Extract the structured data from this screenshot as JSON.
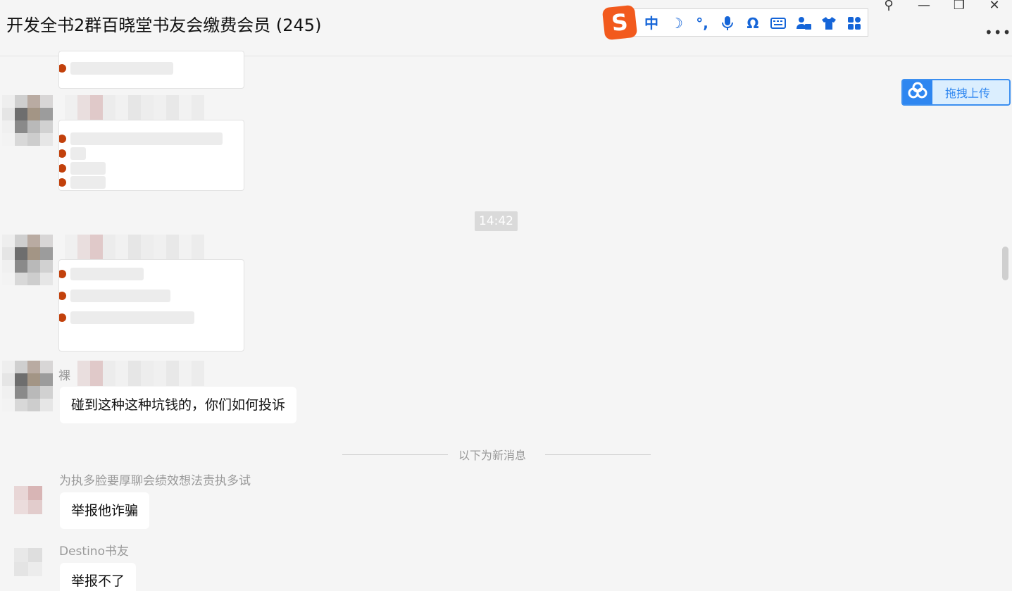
{
  "window": {
    "title": "开发全书2群百晓堂书友会缴费会员 (245)",
    "controls": {
      "pin": "⚲",
      "minimize": "—",
      "restore": "❐",
      "close": "✕",
      "more": "•••"
    }
  },
  "ime_toolbar": {
    "logo": "S",
    "items": [
      {
        "icon": "chinese-mode-icon",
        "glyph": "中"
      },
      {
        "icon": "moon-icon",
        "glyph": "☽"
      },
      {
        "icon": "punctuation-icon",
        "glyph": "°,"
      },
      {
        "icon": "microphone-icon",
        "glyph": "🎙"
      },
      {
        "icon": "omega-icon",
        "glyph": "Ω"
      },
      {
        "icon": "keyboard-icon",
        "glyph": "⌨"
      },
      {
        "icon": "user-card-icon",
        "glyph": "👤"
      },
      {
        "icon": "tshirt-icon",
        "glyph": "👕"
      },
      {
        "icon": "apps-icon",
        "glyph": "▦"
      }
    ]
  },
  "upload_button": {
    "label": "拖拽上传",
    "icon": "cloud-icon"
  },
  "messages": {
    "time_separator": "14:42",
    "msg1_sender_prefix": "裸",
    "msg1_text": "碰到这种这种坑钱的，你们如何投诉",
    "new_messages_label": "以下为新消息",
    "msg2_sender": "为执多脸要厚聊会绩效想法责执多试",
    "msg2_text": "举报他诈骗",
    "msg3_sender": "Destino书友",
    "msg3_text": "举报不了"
  },
  "colors": {
    "accent_blue": "#1565d8",
    "ime_logo": "#f25a1d",
    "upload_border": "#3c8ff0"
  }
}
